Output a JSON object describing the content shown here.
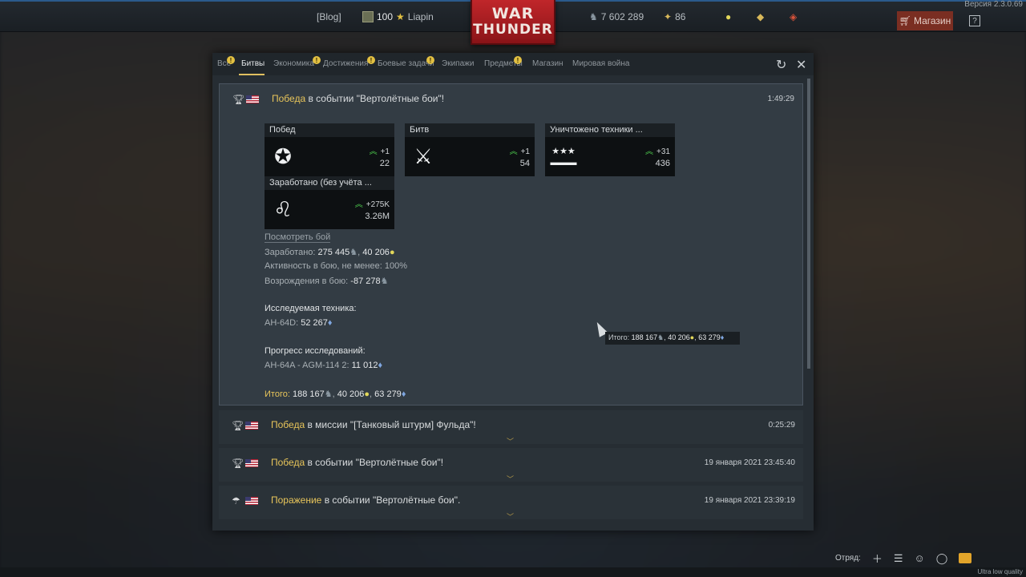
{
  "version": "Версия 2.3.0.69",
  "topbar": {
    "blog": "[Blog]",
    "level": "100",
    "username": "Liapin",
    "logo_line1": "WAR",
    "logo_line2": "THUNDER",
    "silver_lions": "7 602 289",
    "golden_eagles": "86",
    "shop_label": "Магазин",
    "help_label": "?"
  },
  "tabs": [
    {
      "label": "Все",
      "badge": "!"
    },
    {
      "label": "Битвы",
      "badge": ""
    },
    {
      "label": "Экономика",
      "badge": ""
    },
    {
      "label": "Достижения",
      "badge": "!"
    },
    {
      "label": "Боевые задачи",
      "badge": "!"
    },
    {
      "label": "Экипажи",
      "badge": "!"
    },
    {
      "label": "Предметы",
      "badge": ""
    },
    {
      "label": "Магазин",
      "badge": "!"
    },
    {
      "label": "Мировая война",
      "badge": ""
    }
  ],
  "entries": [
    {
      "result": "Победа",
      "text": " в событии \"Вертолётные бои\"!",
      "time": "1:49:29",
      "stats": [
        {
          "title": "Побед",
          "delta": "+1",
          "total": "22",
          "icon": "victory-icon"
        },
        {
          "title": "Битв",
          "delta": "+1",
          "total": "54",
          "icon": "crossed-swords-icon"
        },
        {
          "title": "Уничтожено техники ...",
          "delta": "+31",
          "total": "436",
          "icon": "destroyed-vehicles-icon"
        },
        {
          "title": "Заработано  (без учёта ...",
          "delta": "+275K",
          "total": "3.26M",
          "icon": "lion-icon"
        }
      ],
      "details": {
        "view_battle": "Посмотреть бой",
        "earned_label": "Заработано: ",
        "earned_lions": "275 445",
        "earned_sep": ", ",
        "earned_rp": "40 206",
        "activity": "Активность в бою, не менее: 100%",
        "respawns_label": "Возрождения в бою: ",
        "respawns_value": "-87 278",
        "research_heading": "Исследуемая техника:",
        "research_vehicle": "AH-64D: ",
        "research_value": "52 267",
        "progress_heading": "Прогресс исследований:",
        "progress_item": "AH-64A - AGM-114 2: ",
        "progress_value": "11 012",
        "total_label": "Итого: ",
        "total_lions": "188 167",
        "total_rp": "40 206",
        "total_frp": "63 279"
      },
      "tooltip": {
        "label": "Итого: ",
        "lions": "188 167",
        "rp": "40 206",
        "frp": "63 279"
      }
    },
    {
      "result": "Победа",
      "text": " в миссии \"[Танковый штурм] Фульда\"!",
      "time": "0:25:29"
    },
    {
      "result": "Победа",
      "text": " в событии \"Вертолётные бои\"!",
      "time": "19 января 2021 23:45:40"
    },
    {
      "result": "Поражение",
      "text": " в событии \"Вертолётные бои\".",
      "time": "19 января 2021 23:39:19"
    }
  ],
  "bottom": {
    "squad_label": "Отряд:",
    "quality": "Ultra low quality"
  },
  "colors": {
    "accent": "#e8c55a",
    "shop": "#7a2e22",
    "logo": "#c0262a",
    "positive": "#4fd04f"
  }
}
